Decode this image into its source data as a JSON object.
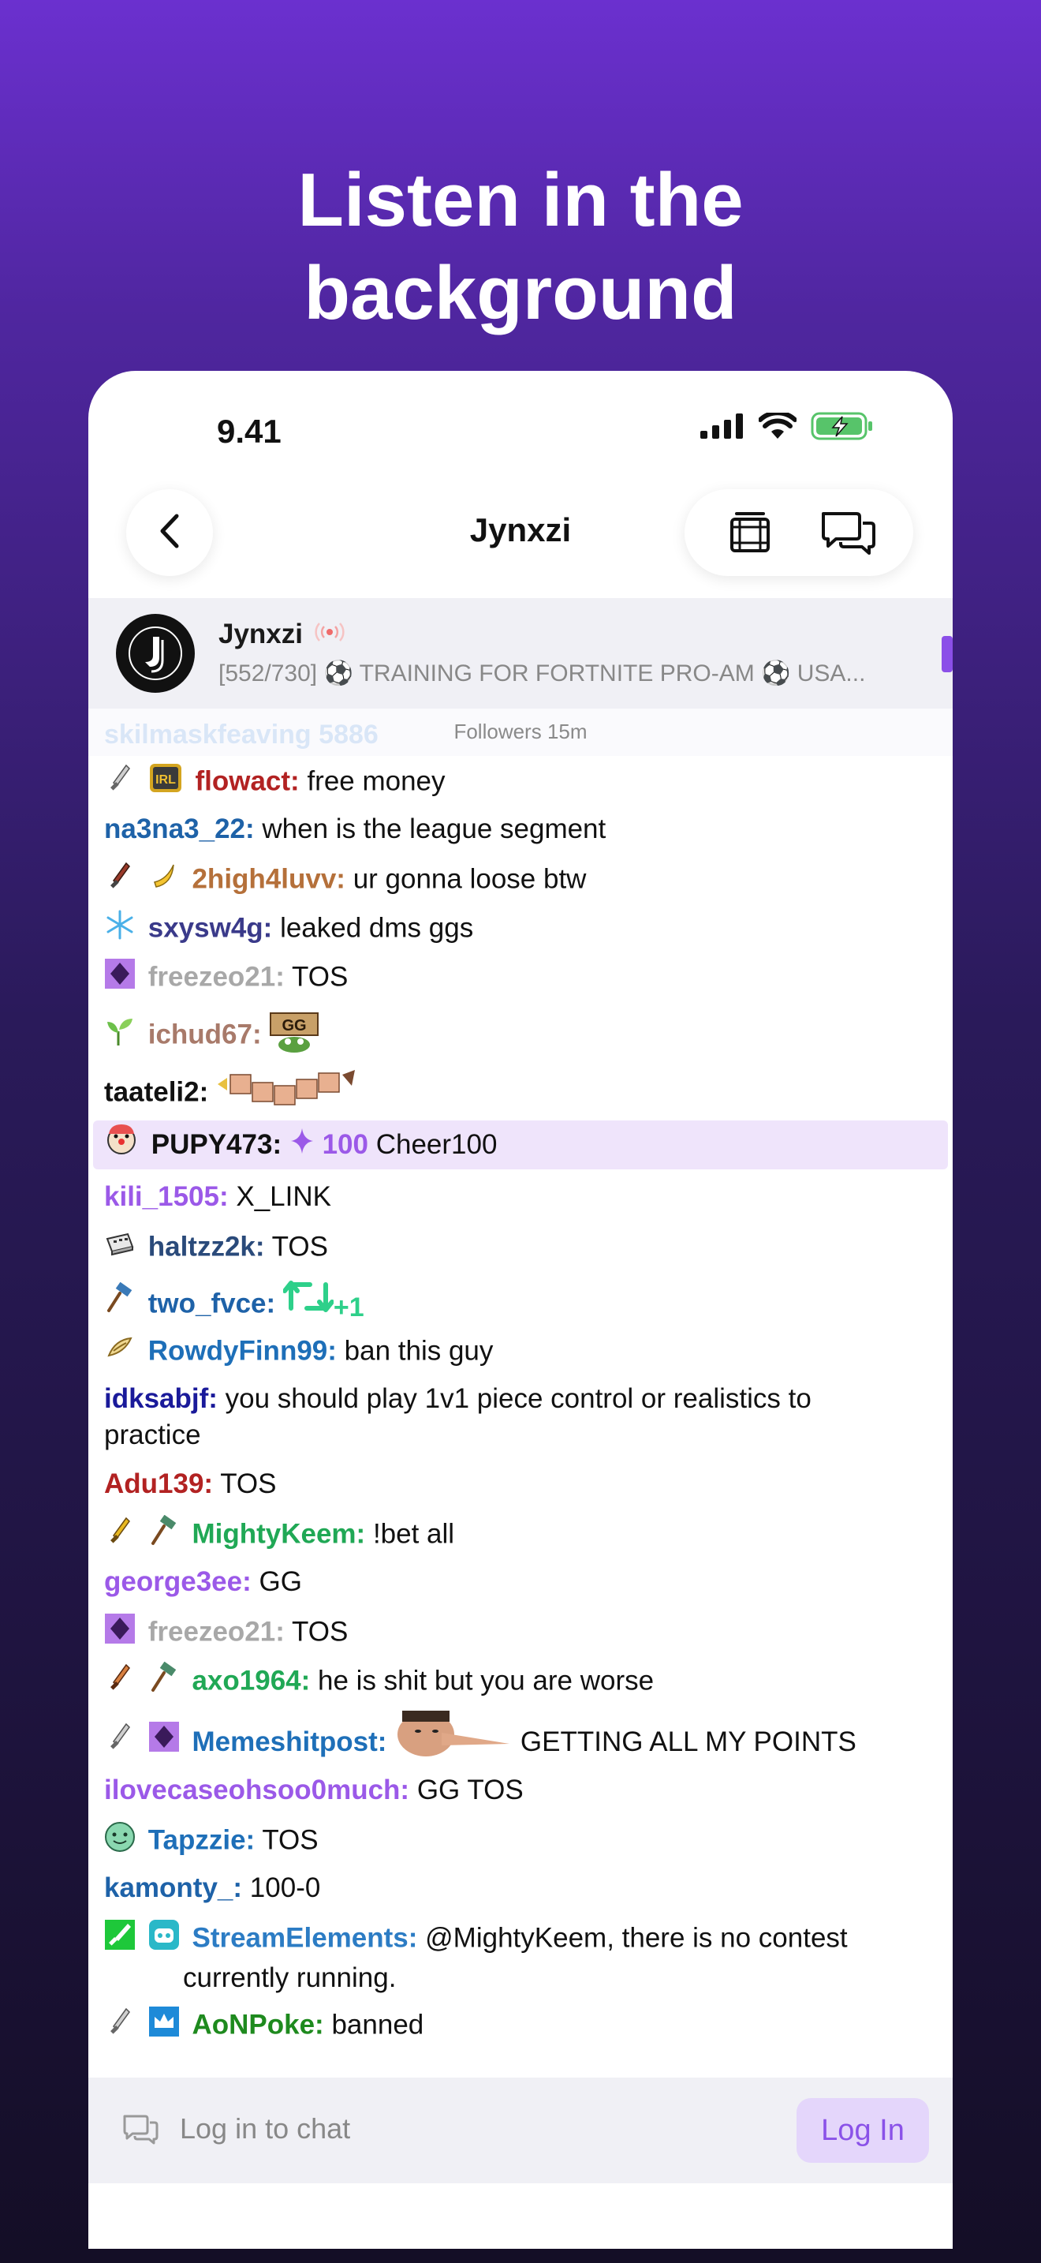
{
  "headline": {
    "line1": "Listen in the",
    "line2": "background"
  },
  "status_bar": {
    "time": "9.41"
  },
  "nav": {
    "title": "Jynxzi",
    "back_icon": "chevron-left-icon",
    "vod_icon": "film-icon",
    "chat_icon": "chat-bubbles-icon"
  },
  "channel": {
    "name": "Jynxzi",
    "live_icon": "live-broadcast-icon",
    "stream_title": "[552/730] ⚽ TRAINING FOR FORTNITE PRO-AM ⚽ USA..."
  },
  "followers_mode": {
    "ghost_user": "skilmaskfeaving",
    "ghost_num": "5886",
    "label": "Followers 15m"
  },
  "messages": [
    {
      "user": "flowact:",
      "text": "free money",
      "color": "#b22222"
    },
    {
      "user": "na3na3_22:",
      "text": "when is the league segment",
      "color": "#1e62a8"
    },
    {
      "user": "2high4luvv:",
      "text": "ur gonna loose btw",
      "color": "#b5703a"
    },
    {
      "user": "sxysw4g:",
      "text": "leaked dms ggs",
      "color": "#3a3a8a"
    },
    {
      "user": "freezeo21:",
      "text": "TOS",
      "color": "#a8a8a8"
    },
    {
      "user": "ichud67:",
      "text": "",
      "color": "#a87a6a"
    },
    {
      "user": "taateli2:",
      "text": "",
      "color": "#111111"
    },
    {
      "user": "PUPY473:",
      "cheer_amount": "100",
      "text": "Cheer100",
      "color": "#111111"
    },
    {
      "user": "kili_1505:",
      "text": "X_LINK",
      "color": "#9b59e8"
    },
    {
      "user": "haltzz2k:",
      "text": "TOS",
      "color": "#2a4a7a"
    },
    {
      "user": "two_fvce:",
      "text": "",
      "emote_text": "+1",
      "color": "#1e62a8"
    },
    {
      "user": "RowdyFinn99:",
      "text": "ban this guy",
      "color": "#1e6fb8"
    },
    {
      "user": "idksabjf:",
      "text": "you should play 1v1 piece control or realistics to",
      "text2": "practice",
      "color": "#1a1a9a"
    },
    {
      "user": "Adu139:",
      "text": "TOS",
      "color": "#b22222"
    },
    {
      "user": "MightyKeem:",
      "text": "!bet all",
      "color": "#20a855"
    },
    {
      "user": "george3ee:",
      "text": "GG",
      "color": "#9b59e8"
    },
    {
      "user": "freezeo21:",
      "text": "TOS",
      "color": "#a8a8a8"
    },
    {
      "user": "axo1964:",
      "text": "he is shit but you are worse",
      "color": "#20a855"
    },
    {
      "user": "Memeshitpost:",
      "text": "GETTING ALL MY POINTS",
      "color": "#1e6fb8"
    },
    {
      "user": "ilovecaseohsoo0much:",
      "text": "GG TOS",
      "color": "#9b59e8"
    },
    {
      "user": "Tapzzie:",
      "text": "TOS",
      "color": "#1e6fb8"
    },
    {
      "user": "kamonty_:",
      "text": "100-0",
      "color": "#1e62a8"
    },
    {
      "user": "StreamElements:",
      "text": "@MightyKeem, there is no contest",
      "text2": "currently running.",
      "color": "#2c7cc4"
    },
    {
      "user": "AoNPoke:",
      "text": "banned",
      "color": "#1e8a1e"
    }
  ],
  "chat_input": {
    "placeholder": "Log in to chat",
    "login_label": "Log In",
    "icon": "chat-bubbles-icon"
  },
  "colors": {
    "accent": "#8a52e8",
    "background_top": "#6b30cf",
    "background_bottom": "#140e26"
  }
}
